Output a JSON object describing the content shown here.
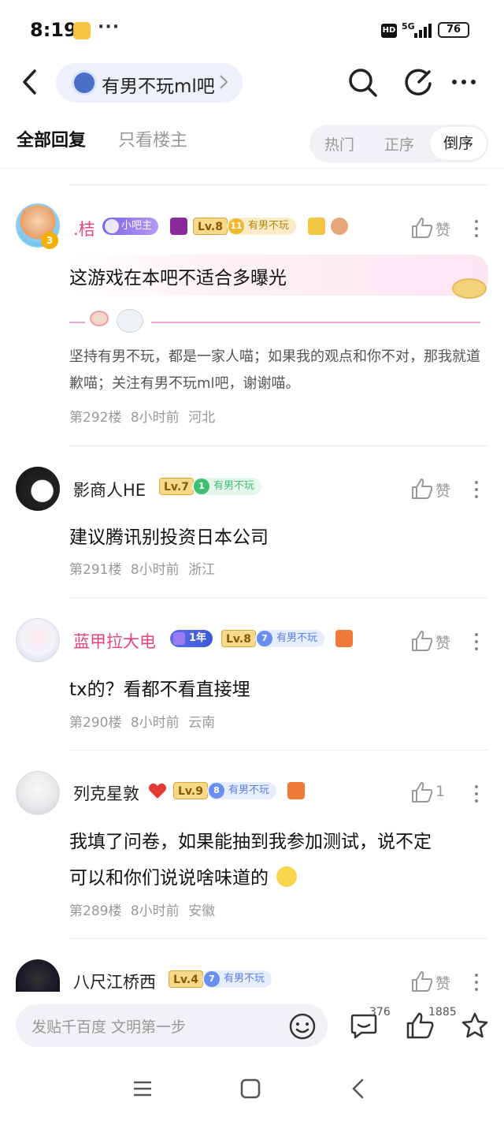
{
  "status": {
    "time": "8:19",
    "hd": "HD",
    "network": "5G",
    "battery": "76"
  },
  "header": {
    "forum_name": "有男不玩ml吧"
  },
  "tabs": {
    "all": "全部回复",
    "owner_only": "只看楼主",
    "sort": [
      "热门",
      "正序",
      "倒序"
    ],
    "active_sort": "倒序"
  },
  "posts": [
    {
      "name": ".桔",
      "name_color": "#e8437a",
      "badges": {
        "role": "小吧主",
        "level": "Lv.8",
        "fan_num": "11",
        "fan": "有男不玩",
        "avatar_level": "3"
      },
      "like": "赞",
      "bubble_text": "这游戏在本吧不适合多曝光",
      "signature": "坚持有男不玩，都是一家人喵；如果我的观点和你不对，那我就道歉喵；关注有男不玩ml吧，谢谢喵。",
      "floor": "第292楼",
      "time": "8小时前",
      "location": "河北"
    },
    {
      "name": "影商人HE",
      "name_color": "#222222",
      "badges": {
        "level": "Lv.7",
        "fan_num": "1",
        "fan": "有男不玩"
      },
      "like": "赞",
      "content": "建议腾讯别投资日本公司",
      "floor": "第291楼",
      "time": "8小时前",
      "location": "浙江"
    },
    {
      "name": "蓝甲拉大电",
      "name_color": "#e8437a",
      "badges": {
        "years": "1年",
        "level": "Lv.8",
        "fan_num": "7",
        "fan": "有男不玩"
      },
      "like": "赞",
      "content": "tx的？看都不看直接埋",
      "floor": "第290楼",
      "time": "8小时前",
      "location": "云南"
    },
    {
      "name": "列克星敦",
      "name_color": "#222222",
      "badges": {
        "level": "Lv.9",
        "fan_num": "8",
        "fan": "有男不玩"
      },
      "like": "1",
      "content_line1": "我填了问卷，如果能抽到我参加测试，说不定",
      "content_line2": "可以和你们说说啥味道的",
      "floor": "第289楼",
      "time": "8小时前",
      "location": "安徽"
    },
    {
      "name": "八尺江桥西",
      "name_color": "#222222",
      "badges": {
        "level": "Lv.4",
        "fan_num": "7",
        "fan": "有男不玩"
      },
      "like": "赞"
    }
  ],
  "bottom": {
    "placeholder": "发贴千百度 文明第一步",
    "comments": "376",
    "likes": "1885"
  },
  "colors": {
    "accent_blue": "#4a6fc8",
    "pink": "#e8437a",
    "green": "#3fbf74",
    "blue_fan": "#6b8ff0"
  }
}
